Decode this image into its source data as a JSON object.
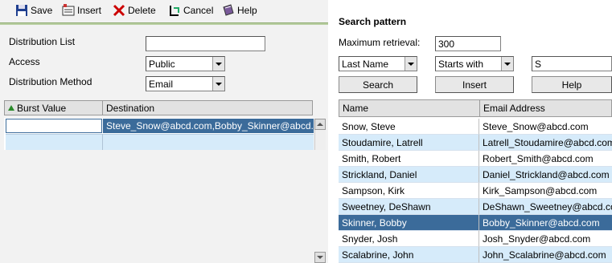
{
  "toolbar": {
    "save": "Save",
    "insert": "Insert",
    "delete": "Delete",
    "cancel": "Cancel",
    "help": "Help"
  },
  "form": {
    "distribution_list_label": "Distribution List",
    "distribution_list_value": "",
    "access_label": "Access",
    "access_value": "Public",
    "method_label": "Distribution Method",
    "method_value": "Email"
  },
  "burst_grid": {
    "col_burst": "Burst Value",
    "col_destination": "Destination",
    "rows": [
      {
        "burst": "",
        "destination": "Steve_Snow@abcd.com,Bobby_Skinner@abcd.com"
      }
    ]
  },
  "search": {
    "title": "Search pattern",
    "max_label": "Maximum retrieval:",
    "max_value": "300",
    "field_select": "Last Name",
    "op_select": "Starts with",
    "term_value": "S",
    "btn_search": "Search",
    "btn_insert": "Insert",
    "btn_help": "Help"
  },
  "results": {
    "col_name": "Name",
    "col_email": "Email Address",
    "rows": [
      {
        "name": "Snow, Steve",
        "email": "Steve_Snow@abcd.com"
      },
      {
        "name": "Stoudamire, Latrell",
        "email": "Latrell_Stoudamire@abcd.com"
      },
      {
        "name": "Smith, Robert",
        "email": "Robert_Smith@abcd.com"
      },
      {
        "name": "Strickland, Daniel",
        "email": "Daniel_Strickland@abcd.com"
      },
      {
        "name": "Sampson, Kirk",
        "email": "Kirk_Sampson@abcd.com"
      },
      {
        "name": "Sweetney, DeShawn",
        "email": "DeShawn_Sweetney@abcd.com"
      },
      {
        "name": "Skinner, Bobby",
        "email": "Bobby_Skinner@abcd.com"
      },
      {
        "name": "Snyder, Josh",
        "email": "Josh_Snyder@abcd.com"
      },
      {
        "name": "Scalabrine, John",
        "email": "John_Scalabrine@abcd.com"
      }
    ]
  },
  "colors": {
    "selection": "#3b6b9a",
    "alt_row": "#d6ebfa",
    "toolbar_accent": "#b9cfa2"
  }
}
